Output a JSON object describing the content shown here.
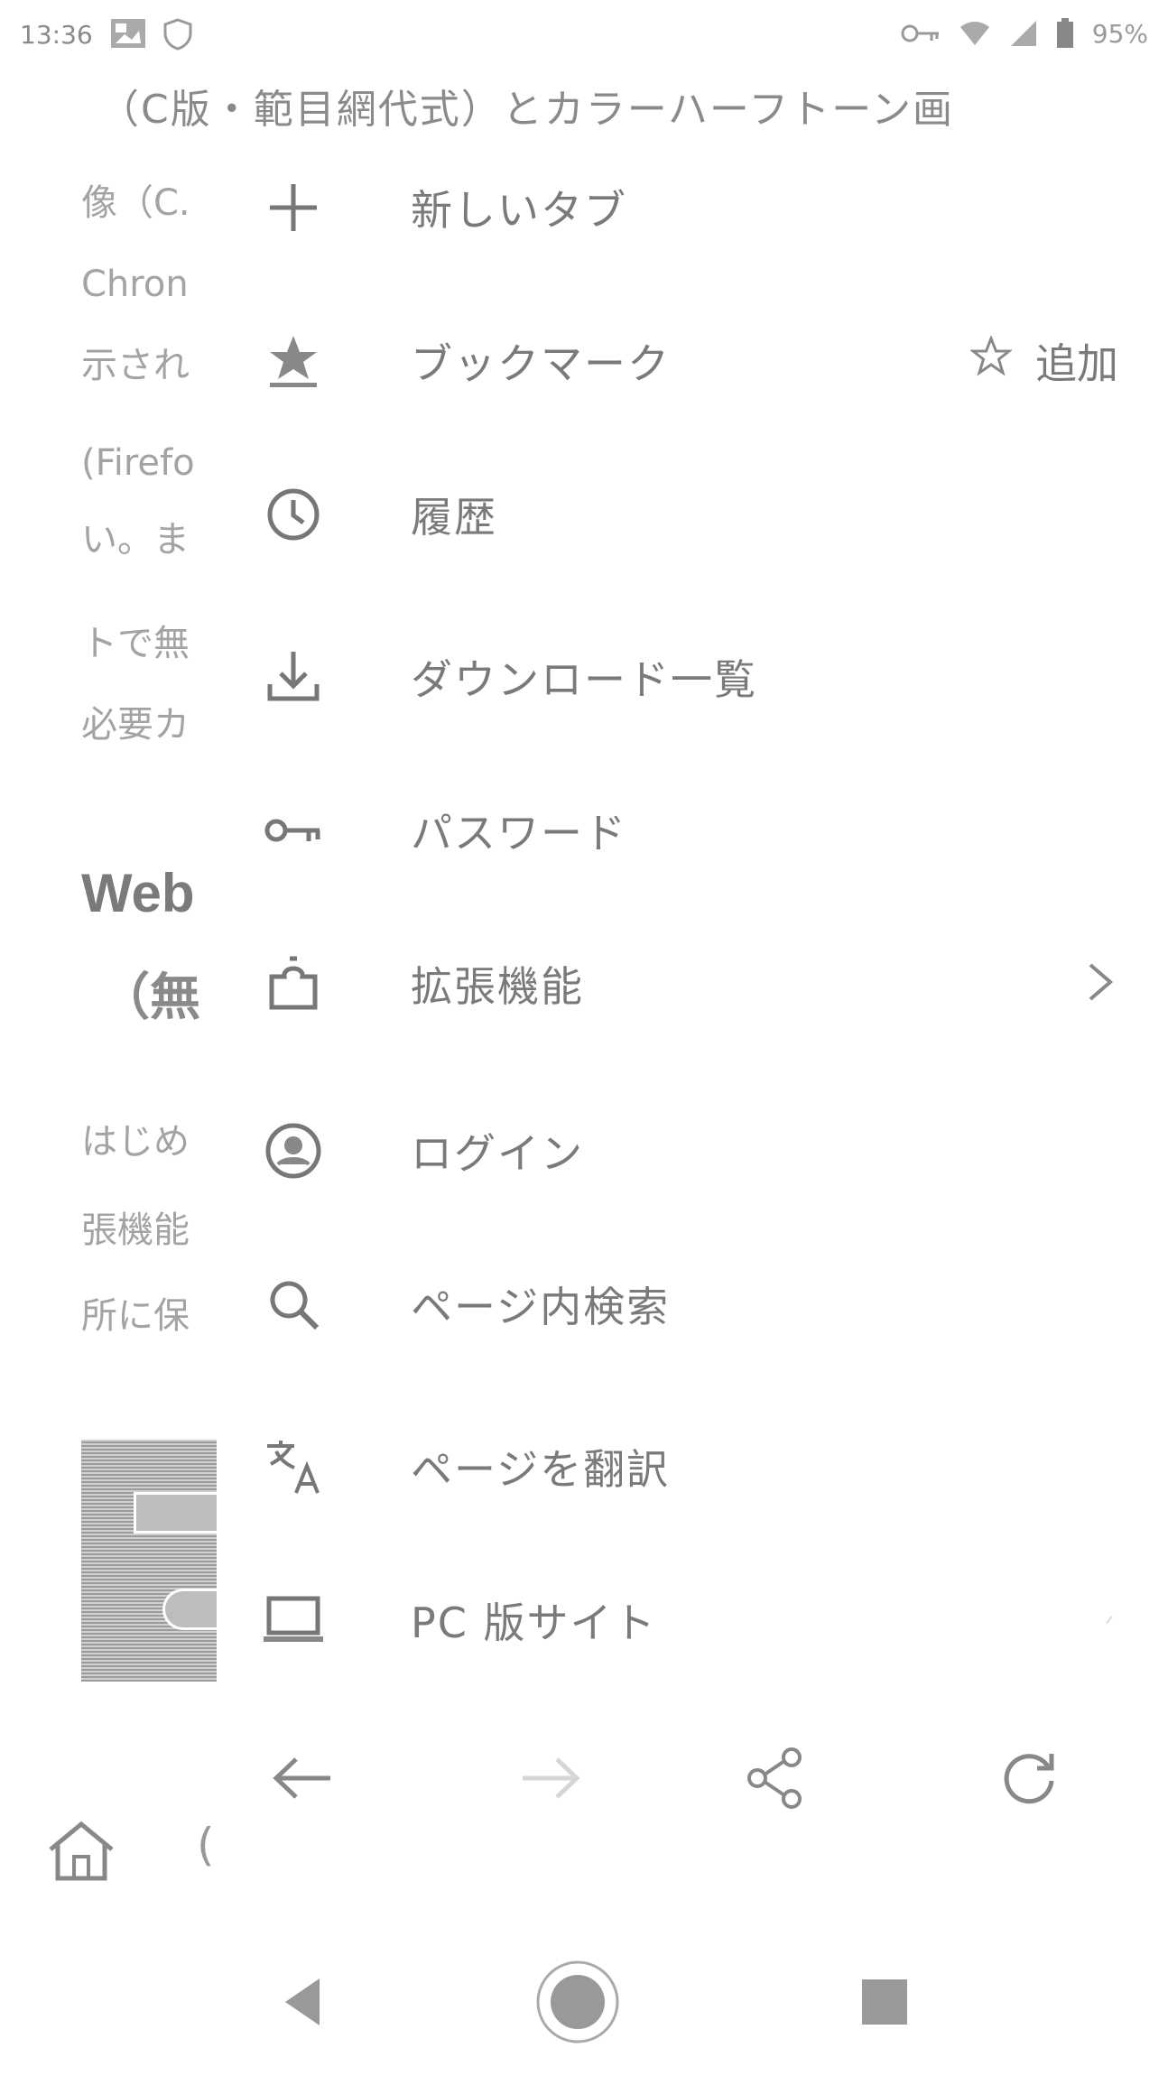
{
  "status_bar": {
    "time": "13:36",
    "battery": "95%"
  },
  "background_page": {
    "title_line": "（C版・範目網代式）とカラーハーフトーン画",
    "lines": [
      "像（C.",
      "Chron",
      "示され",
      "(Firefo",
      "い。ま",
      "トで無",
      "必要カ"
    ],
    "heading": "Web",
    "subheading": "（無",
    "lines2": [
      "はじめ",
      "張機能",
      "所に保"
    ],
    "bottom_partial": "("
  },
  "menu": {
    "items": [
      {
        "id": "new-tab",
        "label": "新しいタブ",
        "icon": "plus-icon"
      },
      {
        "id": "bookmarks",
        "label": "ブックマーク",
        "icon": "star-filled-icon",
        "trailing_label": "追加",
        "trailing_icon": "star-outline-icon"
      },
      {
        "id": "history",
        "label": "履歴",
        "icon": "clock-icon"
      },
      {
        "id": "downloads",
        "label": "ダウンロード一覧",
        "icon": "download-icon"
      },
      {
        "id": "passwords",
        "label": "パスワード",
        "icon": "key-icon"
      },
      {
        "id": "extensions",
        "label": "拡張機能",
        "icon": "puzzle-icon",
        "chevron": "chevron-right-icon"
      },
      {
        "id": "login",
        "label": "ログイン",
        "icon": "account-icon"
      },
      {
        "id": "find-in-page",
        "label": "ページ内検索",
        "icon": "search-icon"
      },
      {
        "id": "translate",
        "label": "ページを翻訳",
        "icon": "translate-icon"
      },
      {
        "id": "desktop-site",
        "label": "PC 版サイト",
        "icon": "laptop-icon"
      }
    ],
    "toolbar": [
      "back-arrow-icon",
      "forward-arrow-icon",
      "share-icon",
      "reload-icon"
    ]
  },
  "nav_bar": [
    "back-triangle-icon",
    "home-circle-icon",
    "recents-square-icon"
  ]
}
